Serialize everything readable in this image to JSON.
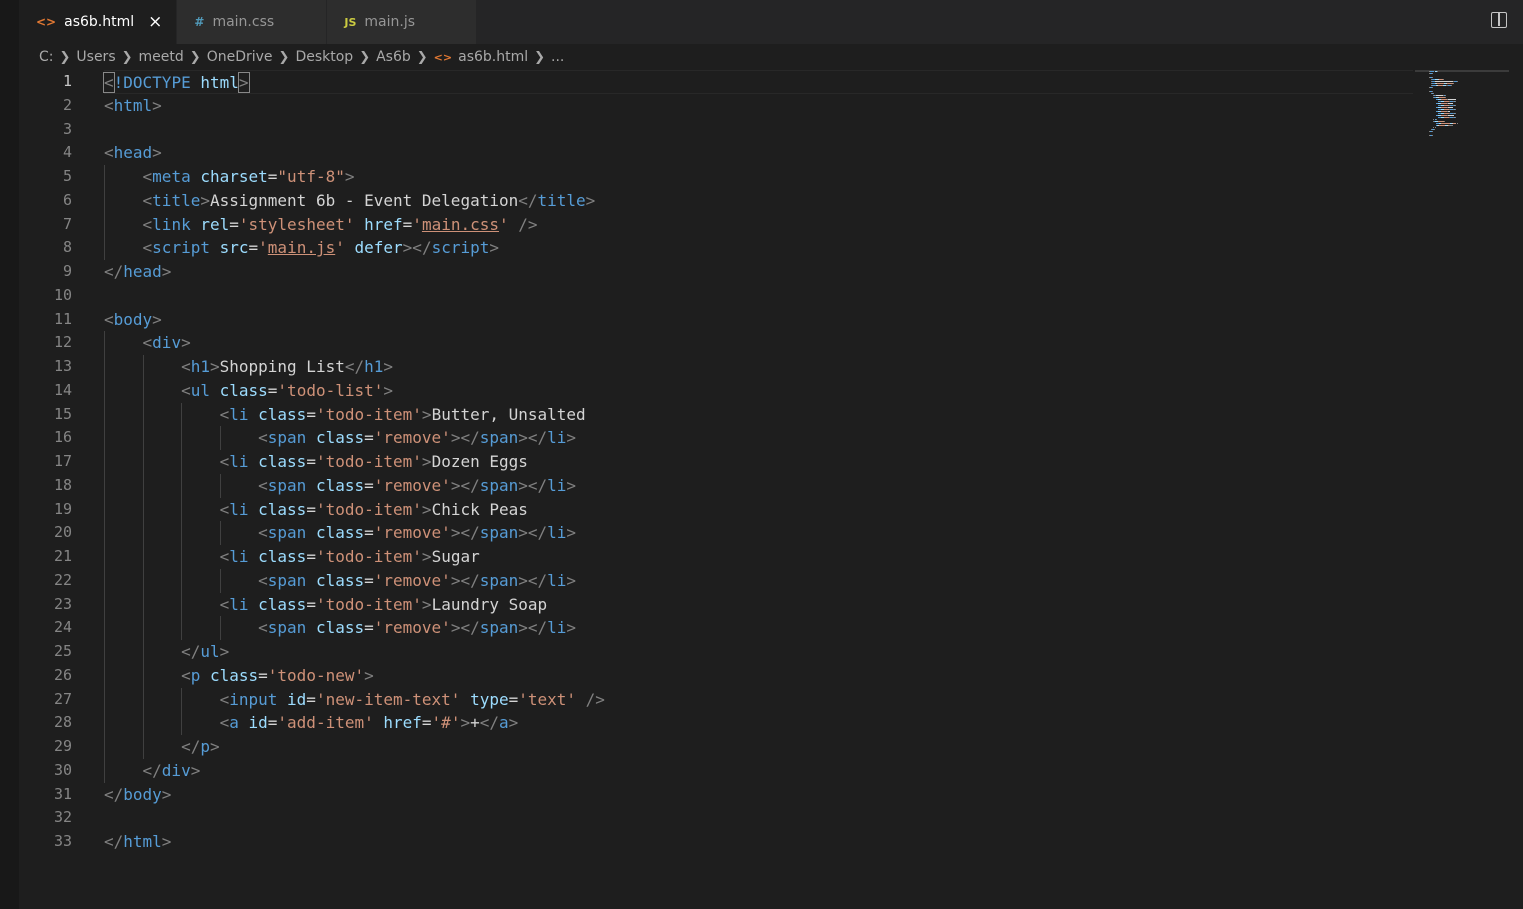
{
  "tabs": [
    {
      "icon": "<>",
      "label": "as6b.html",
      "active": true,
      "close": "×"
    },
    {
      "icon": "#",
      "label": "main.css",
      "active": false
    },
    {
      "icon": "JS",
      "label": "main.js",
      "active": false
    }
  ],
  "breadcrumb": [
    "C:",
    "Users",
    "meetd",
    "OneDrive",
    "Desktop",
    "As6b",
    "as6b.html",
    "..."
  ],
  "current_line": 1,
  "lines": [
    [
      [
        "punc",
        "<"
      ],
      [
        "tag",
        "!DOCTYPE "
      ],
      [
        "attr",
        "html"
      ],
      [
        "punc",
        ">"
      ]
    ],
    [
      [
        "punc",
        "<"
      ],
      [
        "tag",
        "html"
      ],
      [
        "punc",
        ">"
      ]
    ],
    [],
    [
      [
        "punc",
        "<"
      ],
      [
        "tag",
        "head"
      ],
      [
        "punc",
        ">"
      ]
    ],
    [
      [
        "text",
        "    "
      ],
      [
        "punc",
        "<"
      ],
      [
        "tag",
        "meta "
      ],
      [
        "attr",
        "charset"
      ],
      [
        "text",
        "="
      ],
      [
        "str",
        "\"utf-8\""
      ],
      [
        "punc",
        ">"
      ]
    ],
    [
      [
        "text",
        "    "
      ],
      [
        "punc",
        "<"
      ],
      [
        "tag",
        "title"
      ],
      [
        "punc",
        ">"
      ],
      [
        "text",
        "Assignment 6b - Event Delegation"
      ],
      [
        "punc",
        "</"
      ],
      [
        "tag",
        "title"
      ],
      [
        "punc",
        ">"
      ]
    ],
    [
      [
        "text",
        "    "
      ],
      [
        "punc",
        "<"
      ],
      [
        "tag",
        "link "
      ],
      [
        "attr",
        "rel"
      ],
      [
        "text",
        "="
      ],
      [
        "str",
        "'stylesheet' "
      ],
      [
        "attr",
        "href"
      ],
      [
        "text",
        "="
      ],
      [
        "str",
        "'"
      ],
      [
        "link",
        "main.css"
      ],
      [
        "str",
        "' "
      ],
      [
        "punc",
        "/>"
      ]
    ],
    [
      [
        "text",
        "    "
      ],
      [
        "punc",
        "<"
      ],
      [
        "tag",
        "script "
      ],
      [
        "attr",
        "src"
      ],
      [
        "text",
        "="
      ],
      [
        "str",
        "'"
      ],
      [
        "link",
        "main.js"
      ],
      [
        "str",
        "' "
      ],
      [
        "attr",
        "defer"
      ],
      [
        "punc",
        "></"
      ],
      [
        "tag",
        "script"
      ],
      [
        "punc",
        ">"
      ]
    ],
    [
      [
        "punc",
        "</"
      ],
      [
        "tag",
        "head"
      ],
      [
        "punc",
        ">"
      ]
    ],
    [],
    [
      [
        "punc",
        "<"
      ],
      [
        "tag",
        "body"
      ],
      [
        "punc",
        ">"
      ]
    ],
    [
      [
        "text",
        "    "
      ],
      [
        "punc",
        "<"
      ],
      [
        "tag",
        "div"
      ],
      [
        "punc",
        ">"
      ]
    ],
    [
      [
        "text",
        "        "
      ],
      [
        "punc",
        "<"
      ],
      [
        "tag",
        "h1"
      ],
      [
        "punc",
        ">"
      ],
      [
        "text",
        "Shopping List"
      ],
      [
        "punc",
        "</"
      ],
      [
        "tag",
        "h1"
      ],
      [
        "punc",
        ">"
      ]
    ],
    [
      [
        "text",
        "        "
      ],
      [
        "punc",
        "<"
      ],
      [
        "tag",
        "ul "
      ],
      [
        "attr",
        "class"
      ],
      [
        "text",
        "="
      ],
      [
        "str",
        "'todo-list'"
      ],
      [
        "punc",
        ">"
      ]
    ],
    [
      [
        "text",
        "            "
      ],
      [
        "punc",
        "<"
      ],
      [
        "tag",
        "li "
      ],
      [
        "attr",
        "class"
      ],
      [
        "text",
        "="
      ],
      [
        "str",
        "'todo-item'"
      ],
      [
        "punc",
        ">"
      ],
      [
        "text",
        "Butter, Unsalted"
      ]
    ],
    [
      [
        "text",
        "                "
      ],
      [
        "punc",
        "<"
      ],
      [
        "tag",
        "span "
      ],
      [
        "attr",
        "class"
      ],
      [
        "text",
        "="
      ],
      [
        "str",
        "'remove'"
      ],
      [
        "punc",
        "></"
      ],
      [
        "tag",
        "span"
      ],
      [
        "punc",
        "></"
      ],
      [
        "tag",
        "li"
      ],
      [
        "punc",
        ">"
      ]
    ],
    [
      [
        "text",
        "            "
      ],
      [
        "punc",
        "<"
      ],
      [
        "tag",
        "li "
      ],
      [
        "attr",
        "class"
      ],
      [
        "text",
        "="
      ],
      [
        "str",
        "'todo-item'"
      ],
      [
        "punc",
        ">"
      ],
      [
        "text",
        "Dozen Eggs"
      ]
    ],
    [
      [
        "text",
        "                "
      ],
      [
        "punc",
        "<"
      ],
      [
        "tag",
        "span "
      ],
      [
        "attr",
        "class"
      ],
      [
        "text",
        "="
      ],
      [
        "str",
        "'remove'"
      ],
      [
        "punc",
        "></"
      ],
      [
        "tag",
        "span"
      ],
      [
        "punc",
        "></"
      ],
      [
        "tag",
        "li"
      ],
      [
        "punc",
        ">"
      ]
    ],
    [
      [
        "text",
        "            "
      ],
      [
        "punc",
        "<"
      ],
      [
        "tag",
        "li "
      ],
      [
        "attr",
        "class"
      ],
      [
        "text",
        "="
      ],
      [
        "str",
        "'todo-item'"
      ],
      [
        "punc",
        ">"
      ],
      [
        "text",
        "Chick Peas"
      ]
    ],
    [
      [
        "text",
        "                "
      ],
      [
        "punc",
        "<"
      ],
      [
        "tag",
        "span "
      ],
      [
        "attr",
        "class"
      ],
      [
        "text",
        "="
      ],
      [
        "str",
        "'remove'"
      ],
      [
        "punc",
        "></"
      ],
      [
        "tag",
        "span"
      ],
      [
        "punc",
        "></"
      ],
      [
        "tag",
        "li"
      ],
      [
        "punc",
        ">"
      ]
    ],
    [
      [
        "text",
        "            "
      ],
      [
        "punc",
        "<"
      ],
      [
        "tag",
        "li "
      ],
      [
        "attr",
        "class"
      ],
      [
        "text",
        "="
      ],
      [
        "str",
        "'todo-item'"
      ],
      [
        "punc",
        ">"
      ],
      [
        "text",
        "Sugar"
      ]
    ],
    [
      [
        "text",
        "                "
      ],
      [
        "punc",
        "<"
      ],
      [
        "tag",
        "span "
      ],
      [
        "attr",
        "class"
      ],
      [
        "text",
        "="
      ],
      [
        "str",
        "'remove'"
      ],
      [
        "punc",
        "></"
      ],
      [
        "tag",
        "span"
      ],
      [
        "punc",
        "></"
      ],
      [
        "tag",
        "li"
      ],
      [
        "punc",
        ">"
      ]
    ],
    [
      [
        "text",
        "            "
      ],
      [
        "punc",
        "<"
      ],
      [
        "tag",
        "li "
      ],
      [
        "attr",
        "class"
      ],
      [
        "text",
        "="
      ],
      [
        "str",
        "'todo-item'"
      ],
      [
        "punc",
        ">"
      ],
      [
        "text",
        "Laundry Soap"
      ]
    ],
    [
      [
        "text",
        "                "
      ],
      [
        "punc",
        "<"
      ],
      [
        "tag",
        "span "
      ],
      [
        "attr",
        "class"
      ],
      [
        "text",
        "="
      ],
      [
        "str",
        "'remove'"
      ],
      [
        "punc",
        "></"
      ],
      [
        "tag",
        "span"
      ],
      [
        "punc",
        "></"
      ],
      [
        "tag",
        "li"
      ],
      [
        "punc",
        ">"
      ]
    ],
    [
      [
        "text",
        "        "
      ],
      [
        "punc",
        "</"
      ],
      [
        "tag",
        "ul"
      ],
      [
        "punc",
        ">"
      ]
    ],
    [
      [
        "text",
        "        "
      ],
      [
        "punc",
        "<"
      ],
      [
        "tag",
        "p "
      ],
      [
        "attr",
        "class"
      ],
      [
        "text",
        "="
      ],
      [
        "str",
        "'todo-new'"
      ],
      [
        "punc",
        ">"
      ]
    ],
    [
      [
        "text",
        "            "
      ],
      [
        "punc",
        "<"
      ],
      [
        "tag",
        "input "
      ],
      [
        "attr",
        "id"
      ],
      [
        "text",
        "="
      ],
      [
        "str",
        "'new-item-text' "
      ],
      [
        "attr",
        "type"
      ],
      [
        "text",
        "="
      ],
      [
        "str",
        "'text' "
      ],
      [
        "punc",
        "/>"
      ]
    ],
    [
      [
        "text",
        "            "
      ],
      [
        "punc",
        "<"
      ],
      [
        "tag",
        "a "
      ],
      [
        "attr",
        "id"
      ],
      [
        "text",
        "="
      ],
      [
        "str",
        "'add-item' "
      ],
      [
        "attr",
        "href"
      ],
      [
        "text",
        "="
      ],
      [
        "str",
        "'#'"
      ],
      [
        "punc",
        ">"
      ],
      [
        "text",
        "+"
      ],
      [
        "punc",
        "</"
      ],
      [
        "tag",
        "a"
      ],
      [
        "punc",
        ">"
      ]
    ],
    [
      [
        "text",
        "        "
      ],
      [
        "punc",
        "</"
      ],
      [
        "tag",
        "p"
      ],
      [
        "punc",
        ">"
      ]
    ],
    [
      [
        "text",
        "    "
      ],
      [
        "punc",
        "</"
      ],
      [
        "tag",
        "div"
      ],
      [
        "punc",
        ">"
      ]
    ],
    [
      [
        "punc",
        "</"
      ],
      [
        "tag",
        "body"
      ],
      [
        "punc",
        ">"
      ]
    ],
    [],
    [
      [
        "punc",
        "</"
      ],
      [
        "tag",
        "html"
      ],
      [
        "punc",
        ">"
      ]
    ]
  ]
}
